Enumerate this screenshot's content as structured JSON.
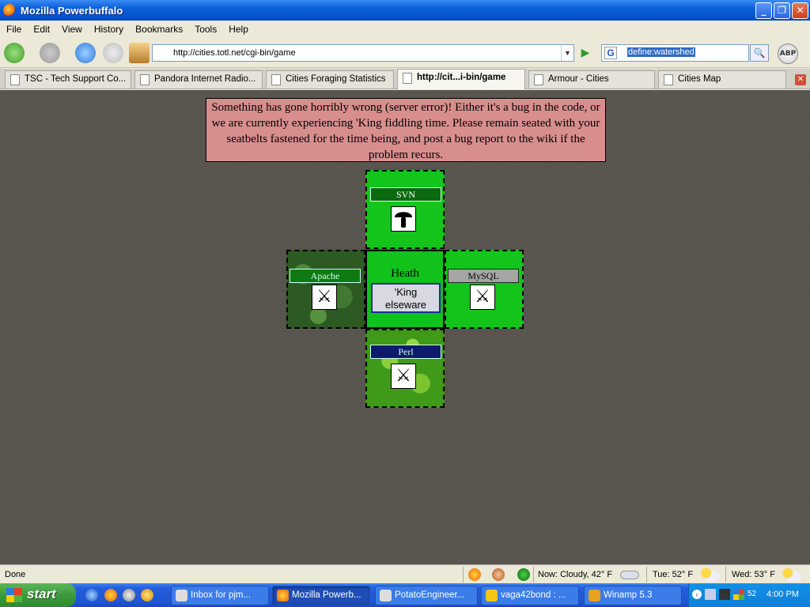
{
  "window": {
    "title": "Mozilla Powerbuffalo"
  },
  "menu": [
    "File",
    "Edit",
    "View",
    "History",
    "Bookmarks",
    "Tools",
    "Help"
  ],
  "nav": {
    "url": "http://cities.totl.net/cgi-bin/game",
    "search_value": "define:watershed",
    "abp_label": "ABP",
    "search_engine_letter": "G"
  },
  "tabs": [
    {
      "label": "TSC - Tech Support Co..."
    },
    {
      "label": "Pandora Internet Radio..."
    },
    {
      "label": "Cities Foraging Statistics"
    },
    {
      "label": "http://cit...i-bin/game"
    },
    {
      "label": "Armour - Cities"
    },
    {
      "label": "Cities Map"
    }
  ],
  "page": {
    "error_message": "Something has gone horribly wrong (server error)! Either it's a bug in the code, or we are currently experiencing 'King fiddling time. Please remain seated with your seatbelts fastened for the time being, and post a bug report to the wiki if the problem recurs.",
    "tiles": {
      "north": {
        "label": "SVN",
        "icon": "mushroom-icon"
      },
      "west": {
        "label": "Apache",
        "icon": "crossed-swords-icon"
      },
      "east": {
        "label": "MySQL",
        "icon": "crossed-swords-icon"
      },
      "south": {
        "label": "Perl",
        "icon": "crossed-swords-icon"
      },
      "center": {
        "name": "Heath",
        "button_label": "'King elseware"
      }
    }
  },
  "status": {
    "text": "Done",
    "now": "Now: Cloudy, 42° F",
    "tue": "Tue: 52° F",
    "wed": "Wed: 53° F"
  },
  "taskbar": {
    "start": "start",
    "tasks": [
      {
        "label": "Inbox for pjm..."
      },
      {
        "label": "Mozilla Powerb..."
      },
      {
        "label": "PotatoEngineer..."
      },
      {
        "label": "vaga42bond : ..."
      },
      {
        "label": "Winamp 5.3"
      }
    ],
    "clock": "4:00 PM",
    "tray_num": "52"
  }
}
